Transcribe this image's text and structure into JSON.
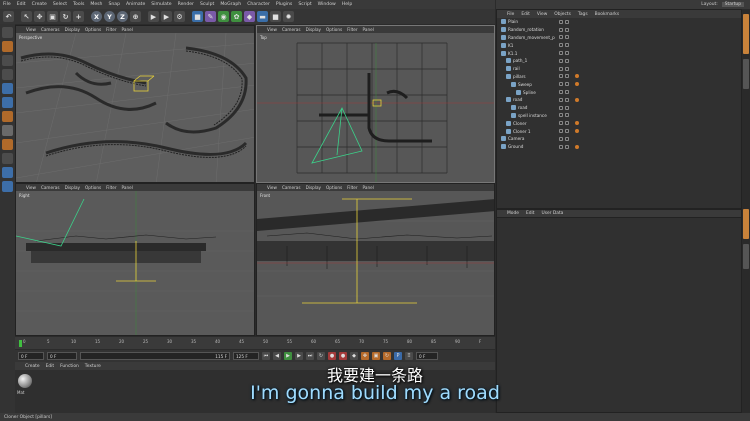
{
  "menu": [
    "File",
    "Edit",
    "Create",
    "Select",
    "Tools",
    "Mesh",
    "Snap",
    "Animate",
    "Simulate",
    "Render",
    "Sculpt",
    "MoGraph",
    "Character",
    "Plugins",
    "Script",
    "Window",
    "Help"
  ],
  "toolbar": {
    "undo_icon": "undo-icon",
    "axes": [
      "X",
      "Y",
      "Z"
    ]
  },
  "layout": {
    "label": "Layout:",
    "value": "Startup"
  },
  "viewports": {
    "menu": [
      "View",
      "Cameras",
      "Display",
      "Options",
      "Filter",
      "Panel"
    ],
    "perspective": {
      "label": "Perspective"
    },
    "top": {
      "label": "Top"
    },
    "right": {
      "label": "Right"
    },
    "front": {
      "label": "Front"
    }
  },
  "timeline": {
    "ticks": [
      "0",
      "5",
      "10",
      "15",
      "20",
      "25",
      "30",
      "35",
      "40",
      "45",
      "50",
      "55",
      "60",
      "65",
      "70",
      "75",
      "80",
      "85",
      "90",
      "F"
    ],
    "start_field": "0 F",
    "min_field": "0 F",
    "max_field": "115 F",
    "end_field": "125 F",
    "current_field": "0 F"
  },
  "material": {
    "menu": [
      "Create",
      "Edit",
      "Function",
      "Texture"
    ],
    "name": "Mat"
  },
  "object_manager": {
    "menu": [
      "File",
      "Edit",
      "View",
      "Objects",
      "Tags",
      "Bookmarks"
    ],
    "objects": [
      {
        "name": "Plain",
        "indent": 0,
        "tag": false
      },
      {
        "name": "Random_rotation",
        "indent": 0,
        "tag": false
      },
      {
        "name": "Random_movement_p",
        "indent": 0,
        "tag": false
      },
      {
        "name": "K1",
        "indent": 0,
        "tag": false
      },
      {
        "name": "K1.1",
        "indent": 0,
        "tag": false
      },
      {
        "name": "path_1",
        "indent": 1,
        "tag": false
      },
      {
        "name": "rail",
        "indent": 1,
        "tag": false
      },
      {
        "name": "pillars",
        "indent": 1,
        "tag": true
      },
      {
        "name": "Sweep",
        "indent": 2,
        "tag": true
      },
      {
        "name": "Spline",
        "indent": 3,
        "tag": false
      },
      {
        "name": "road",
        "indent": 1,
        "tag": true
      },
      {
        "name": "road",
        "indent": 2,
        "tag": false
      },
      {
        "name": "spell instance",
        "indent": 2,
        "tag": false
      },
      {
        "name": "Cloner",
        "indent": 1,
        "tag": true
      },
      {
        "name": "Cloner 1",
        "indent": 1,
        "tag": true
      },
      {
        "name": "Camera",
        "indent": 0,
        "tag": false
      },
      {
        "name": "Ground",
        "indent": 0,
        "tag": true
      }
    ]
  },
  "attribute_manager": {
    "menu": [
      "Mode",
      "Edit",
      "User Data"
    ]
  },
  "status": "Cloner Object [pillars]",
  "subtitles": {
    "zh": "我要建一条路",
    "en": "I'm gonna build my a road"
  }
}
